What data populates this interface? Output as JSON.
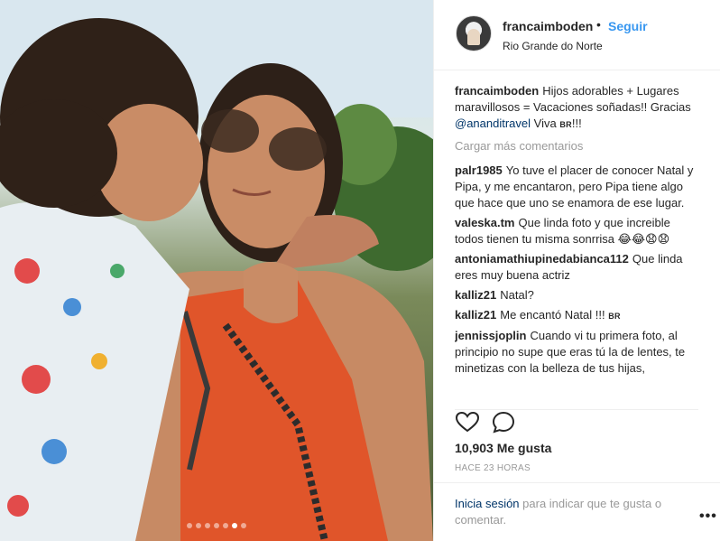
{
  "post": {
    "author": "francaimboden",
    "bullet": "•",
    "follow_label": "Seguir",
    "location": "Rio Grande do Norte",
    "carousel_dots": 7,
    "carousel_active": 6
  },
  "caption": {
    "user": "francaimboden",
    "text_1": "Hijos adorables + Lugares maravillosos = Vacaciones soñadas!! Gracias ",
    "mention": "@ananditravel",
    "text_2": " Viva ",
    "flag": "BR",
    "text_3": "!!!"
  },
  "load_more": "Cargar más comentarios",
  "comments": [
    {
      "user": "palr1985",
      "text": "Yo tuve el placer de conocer Natal y Pipa, y me encantaron, pero Pipa tiene algo que hace que uno se enamora de ese lugar."
    },
    {
      "user": "valeska.tm",
      "text": "Que linda foto y que increible todos tienen tu misma sonrrisa 😂😂😧😧"
    },
    {
      "user": "antoniamathiupinedabianca112",
      "text": "Que linda eres muy buena actriz"
    },
    {
      "user": "kalliz21",
      "text": "Natal?"
    },
    {
      "user": "kalliz21",
      "text": "Me encantó Natal !!!",
      "flag": "BR"
    },
    {
      "user": "jennissjoplin",
      "text": "Cuando vi tu primera foto, al principio no supe que eras tú la de lentes, te minetizas con la belleza de tus hijas,"
    }
  ],
  "likes": "10,903 Me gusta",
  "time": "HACE 23 HORAS",
  "footer": {
    "login_link": "Inicia sesión",
    "login_text": " para indicar que te gusta o comentar.",
    "more": "•••"
  },
  "icons": {
    "heart": "heart-icon",
    "comment": "comment-icon",
    "more": "more-options-icon"
  }
}
